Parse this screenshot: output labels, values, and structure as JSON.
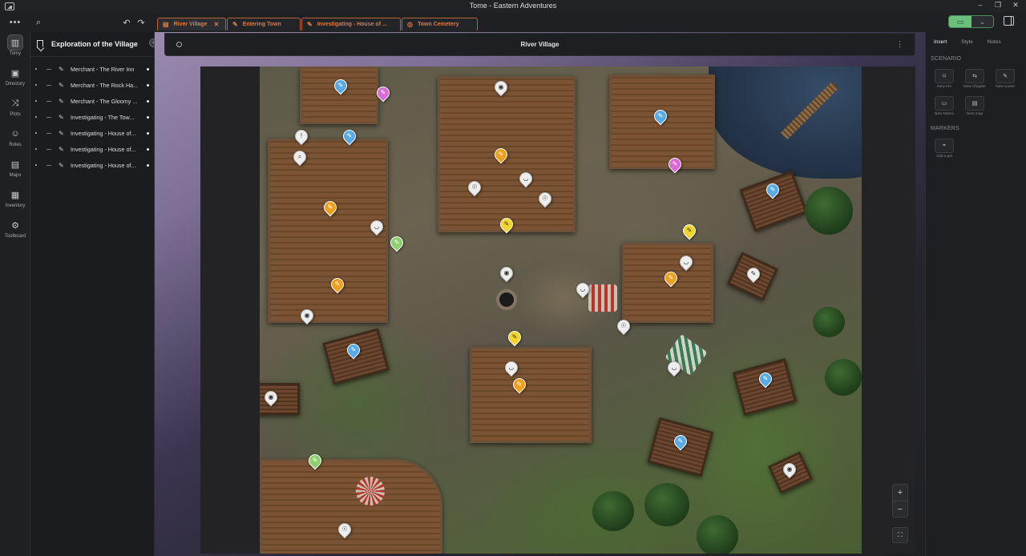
{
  "window": {
    "title": "Tome - Eastern Adventures",
    "controls": [
      "–",
      "❐",
      "✕"
    ]
  },
  "toolbar": {
    "menu": "•••",
    "search": "⌕",
    "undo": "↶",
    "redo": "↷"
  },
  "tabs": [
    {
      "label": "River Village",
      "icon": "map-icon",
      "closable": true
    },
    {
      "label": "Entering Town",
      "icon": "feather-icon"
    },
    {
      "label": "Investigating - House of ...",
      "icon": "feather-icon"
    },
    {
      "label": "Town Cemetery",
      "icon": "compass-icon"
    }
  ],
  "rail": [
    {
      "label": "Tomy",
      "glyph": "▥",
      "active": true
    },
    {
      "label": "Directory",
      "glyph": "▣"
    },
    {
      "label": "Plots",
      "glyph": "⤨"
    },
    {
      "label": "Roles",
      "glyph": "☺"
    },
    {
      "label": "Maps",
      "glyph": "▤"
    },
    {
      "label": "Inventory",
      "glyph": "▦"
    },
    {
      "label": "Toolboard",
      "glyph": "⚙"
    }
  ],
  "explorer": {
    "title": "Exploration of the Village",
    "items": [
      "Merchant - The River Inn",
      "Merchant - The Rock Ha...",
      "Merchant - The Gloomy ...",
      "Investigating - The Tow...",
      "Investigating - House of...",
      "Investigating - House of...",
      "Investigating - House of..."
    ]
  },
  "map": {
    "title": "River Village",
    "zoom_in": "+",
    "zoom_out": "−",
    "fit": "⛶"
  },
  "right_panel": {
    "tabs": [
      "Insert",
      "Style",
      "Notes"
    ],
    "scenario_heading": "SCENARIO",
    "scenario_tools": [
      {
        "label": "New Arc",
        "glyph": "⌑"
      },
      {
        "label": "New Chapter",
        "glyph": "⇆"
      },
      {
        "label": "New scene",
        "glyph": "✎"
      },
      {
        "label": "New Memo",
        "glyph": "▭"
      },
      {
        "label": "New map",
        "glyph": "▤"
      }
    ],
    "markers_heading": "MARKERS",
    "marker_tools": [
      {
        "label": "Add a pin",
        "glyph": "⌖"
      }
    ]
  },
  "colors": {
    "accent_tab": "#e07a45",
    "toggle_green": "#6abf7b"
  }
}
